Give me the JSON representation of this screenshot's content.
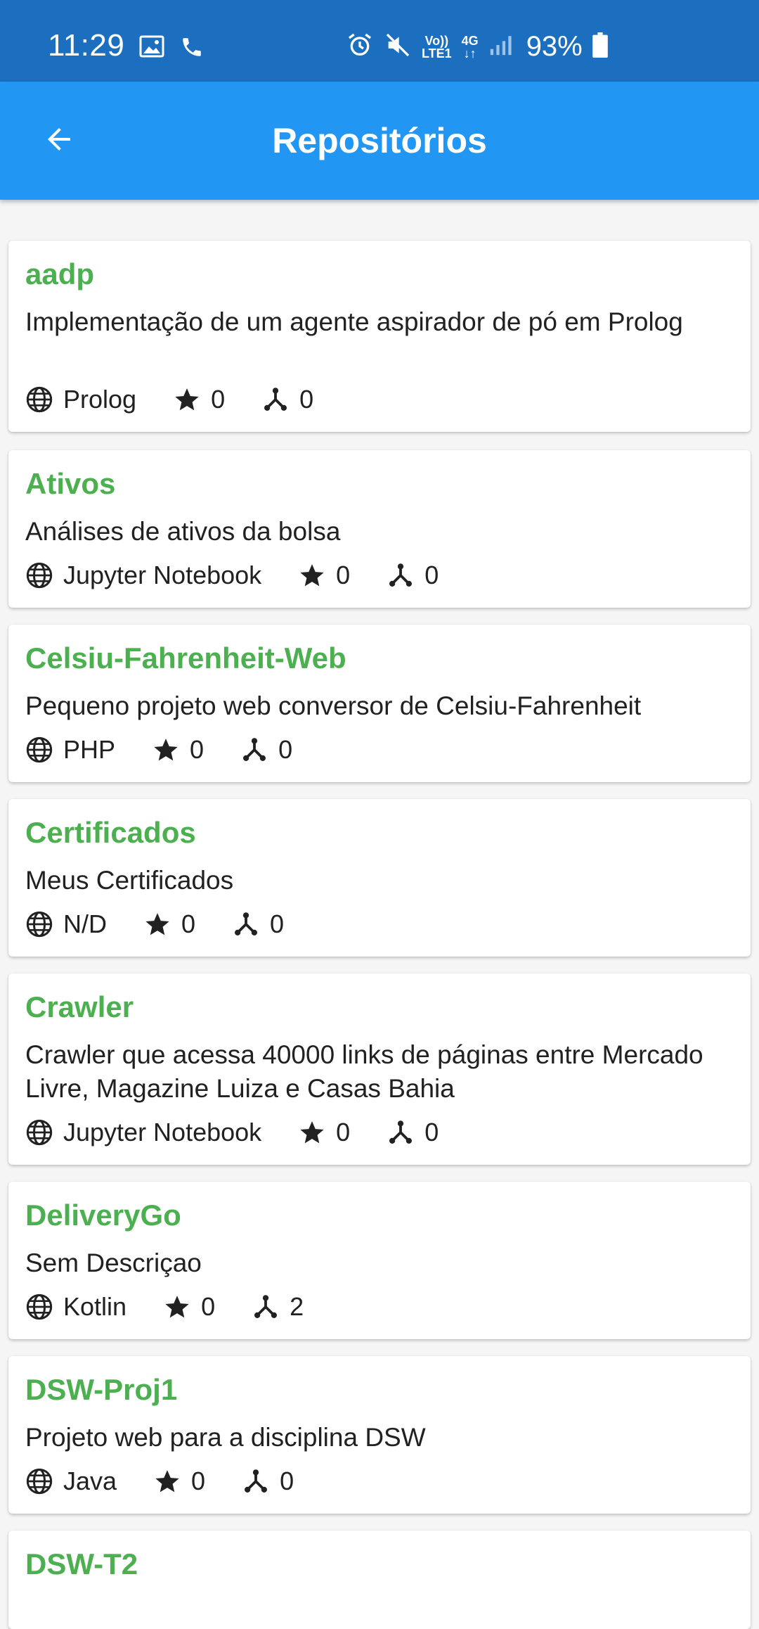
{
  "status_bar": {
    "time": "11:29",
    "battery": "93%",
    "volte_label": "Vo))",
    "lte_label": "LTE1",
    "network_label": "4G"
  },
  "app_bar": {
    "title": "Repositórios"
  },
  "repos": [
    {
      "name": "aadp",
      "description": "Implementação de um agente aspirador de pó em Prolog",
      "language": "Prolog",
      "stars": "0",
      "forks": "0"
    },
    {
      "name": "Ativos",
      "description": "Análises de ativos da bolsa",
      "language": "Jupyter Notebook",
      "stars": "0",
      "forks": "0"
    },
    {
      "name": "Celsiu-Fahrenheit-Web",
      "description": "Pequeno projeto web conversor de  Celsiu-Fahrenheit",
      "language": "PHP",
      "stars": "0",
      "forks": "0"
    },
    {
      "name": "Certificados",
      "description": "Meus Certificados",
      "language": "N/D",
      "stars": "0",
      "forks": "0"
    },
    {
      "name": "Crawler",
      "description": "Crawler que acessa 40000 links de páginas entre Mercado Livre, Magazine Luiza e Casas Bahia",
      "language": "Jupyter Notebook",
      "stars": "0",
      "forks": "0"
    },
    {
      "name": "DeliveryGo",
      "description": "Sem Descriçao",
      "language": "Kotlin",
      "stars": "0",
      "forks": "2"
    },
    {
      "name": "DSW-Proj1",
      "description": "Projeto web para a disciplina DSW",
      "language": "Java",
      "stars": "0",
      "forks": "0"
    },
    {
      "name": "DSW-T2",
      "description": "",
      "language": "",
      "stars": "",
      "forks": ""
    }
  ],
  "colors": {
    "status_bar": "#1c6fbf",
    "app_bar": "#2196f3",
    "repo_name": "#4caf50",
    "background": "#f5f5f5"
  },
  "icons": {
    "language": "globe-icon",
    "stars": "star-icon",
    "forks": "fork-icon"
  }
}
